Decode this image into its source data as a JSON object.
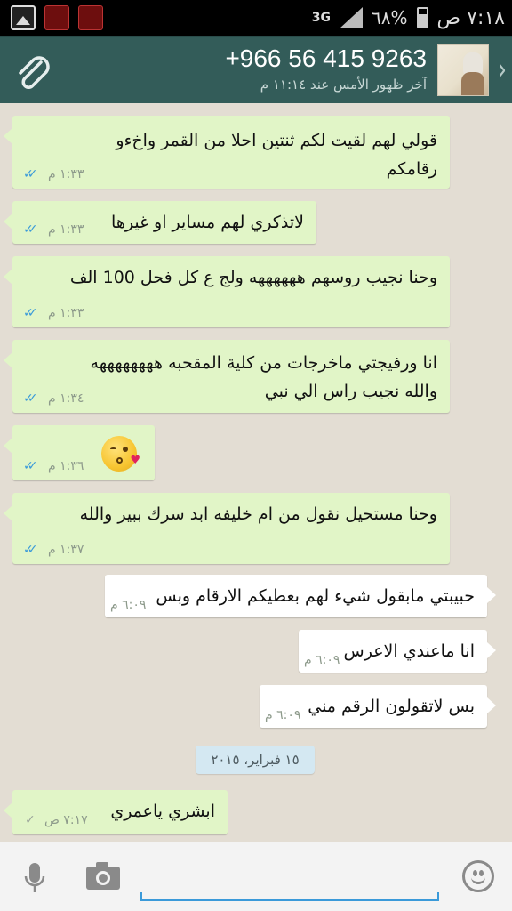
{
  "status_bar": {
    "time": "٧:١٨ ص",
    "battery": "٦٨%",
    "network": "3G"
  },
  "header": {
    "contact_name": "+966 56 415 9263",
    "last_seen": "آخر ظهور الأمس عند ١١:١٤ م"
  },
  "messages": [
    {
      "direction": "out",
      "text": "قولي لهم لقيت لكم ثنتين احلا من القمر  واخءو رقامكم",
      "time": "١:٣٣ م",
      "status": "read"
    },
    {
      "direction": "out",
      "text": "لاتذكري لهم مساير او غيرها",
      "time": "١:٣٣ م",
      "status": "read"
    },
    {
      "direction": "out",
      "text": "وحنا نجيب روسهم ههههههه ولج ع كل فحل 100 الف",
      "time": "١:٣٣ م",
      "status": "read"
    },
    {
      "direction": "out",
      "text": "انا ورفيجتي ماخرجات من كلية المقحبه ههههههههه والله نجيب راس الي نبي",
      "time": "١:٣٤ م",
      "status": "read"
    },
    {
      "direction": "out",
      "text": "",
      "emoji": "kissing-face-with-heart",
      "time": "١:٣٦ م",
      "status": "read"
    },
    {
      "direction": "out",
      "text": "وحنا مستحيل نقول من ام خليفه ابد سرك ببير والله",
      "time": "١:٣٧ م",
      "status": "read"
    },
    {
      "direction": "in",
      "text": "حبيبتي مابقول شيء لهم بعطيكم الارقام وبس",
      "time": "٦:٠٩ م"
    },
    {
      "direction": "in",
      "text": "انا ماعندي الاعرس",
      "time": "٦:٠٩ م"
    },
    {
      "direction": "in",
      "text": "بس لاتقولون الرقم مني",
      "time": "٦:٠٩ م"
    },
    {
      "direction": "out",
      "text": "ابشري ياعمري",
      "time": "٧:١٧ ص",
      "status": "sent"
    }
  ],
  "date_divider": "١٥ فبراير، ٢٠١٥",
  "input": {
    "value": ""
  },
  "colors": {
    "header_bg": "#335c59",
    "outgoing_bubble": "#e1f5c7",
    "incoming_bubble": "#ffffff",
    "read_ticks": "#3a9ad9",
    "date_chip": "#d4e8f2"
  },
  "icons": {
    "attach": "paperclip-icon",
    "back": "chevron-right-icon",
    "mic": "microphone-icon",
    "camera": "camera-icon",
    "emoji": "smiley-icon"
  }
}
